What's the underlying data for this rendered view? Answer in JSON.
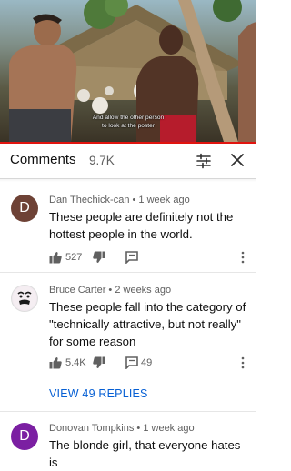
{
  "video": {
    "subtitle_line1": "And allow the other person",
    "subtitle_line2": "to look at the poster",
    "progress": 1.0,
    "progress_color": "#e1140f"
  },
  "header": {
    "title": "Comments",
    "count": "9.7K",
    "filter_icon": "sort-filter-icon",
    "close_icon": "close-icon"
  },
  "comments": [
    {
      "author": "Dan Thechick-can",
      "time": "1 week ago",
      "avatar_letter": "D",
      "avatar_color": "#6e4236",
      "text": [
        "These people are definitely not the",
        "hottest people in the world."
      ],
      "likes": "527",
      "replies": ""
    },
    {
      "author": "Bruce Carter",
      "time": "2 weeks ago",
      "avatar_letter": "",
      "avatar_color": "#f1e9ef",
      "text": [
        "These people fall into the category of",
        "\"technically attractive, but not really\"",
        "for some reason"
      ],
      "likes": "5.4K",
      "replies": "49",
      "view_replies": "VIEW 49 REPLIES"
    },
    {
      "author": "Donovan Tompkins",
      "time": "1 week ago",
      "avatar_letter": "D",
      "avatar_color": "#7b1fa2",
      "text": [
        "The blonde girl, that everyone hates is"
      ]
    }
  ],
  "separator": " • "
}
